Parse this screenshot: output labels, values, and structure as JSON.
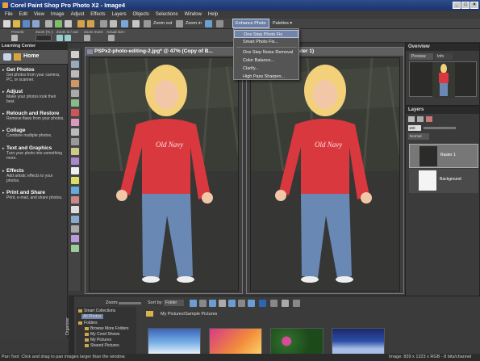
{
  "window": {
    "title": "Corel Paint Shop Pro Photo X2 - Image4",
    "min": "_",
    "max": "□",
    "close": "×"
  },
  "menu": [
    "File",
    "Edit",
    "View",
    "Image",
    "Adjust",
    "Effects",
    "Layers",
    "Objects",
    "Selections",
    "Window",
    "Help"
  ],
  "toolbar": {
    "zoom_out": "Zoom out",
    "zoom_in": "Zoom in",
    "enhance_photo": "Enhance Photo ▾",
    "palettes": "Palettes ▾"
  },
  "tool_options": {
    "presets": "Presets:",
    "zoom_pct": "Zoom (% ):",
    "zoom_in_out": "Zoom in / out:",
    "zoom_more": "Zoom more:",
    "actual_size": "Actual size:"
  },
  "enhance_menu": [
    "One Step Photo Fix",
    "Smart Photo Fix...",
    "One Step Noise Removal",
    "Color Balance...",
    "Clarify...",
    "High Pass Sharpen..."
  ],
  "learning_center": {
    "title": "Learning Center",
    "home": "Home",
    "sections": [
      {
        "heading": "Get Photos",
        "desc": "Get photos from your camera, PC, or scanner."
      },
      {
        "heading": "Adjust",
        "desc": "Make your photos look their best."
      },
      {
        "heading": "Retouch and Restore",
        "desc": "Remove flaws from your photos."
      },
      {
        "heading": "Collage",
        "desc": "Combine multiple photos."
      },
      {
        "heading": "Text and Graphics",
        "desc": "Turn your photo into something more."
      },
      {
        "heading": "Effects",
        "desc": "Add artistic effects to your photos."
      },
      {
        "heading": "Print and Share",
        "desc": "Print, e-mail, and share photos."
      }
    ]
  },
  "image_windows": [
    {
      "title": "PSPx2-photo-editing-2.jpg* @  47% (Copy of B..."
    },
    {
      "title": "aster 1)"
    }
  ],
  "photo_text": "Old Navy",
  "overview": {
    "title": "Overview",
    "tab_preview": "Preview",
    "tab_info": "Info"
  },
  "layers": {
    "title": "Layers",
    "opacity": "100",
    "blend": "Normal",
    "items": [
      {
        "name": "Raster 1"
      },
      {
        "name": "Background"
      }
    ]
  },
  "organizer": {
    "zoom": "Zoom:",
    "sort_by": "Sort by:",
    "sort_value": "Folder",
    "path": "My Pictures\\Sample Pictures",
    "side_label": "Organizer",
    "tree": [
      "Smart Collections",
      "All Photos",
      "Folders",
      "Browse More Folders",
      "My Corel Shows",
      "My Pictures",
      "Shared Pictures"
    ]
  },
  "status": {
    "left": "Pan Tool: Click and drag to pan images larger than the window.",
    "right": "Image:  839 x 1323 x RGB - 8 bits/channel"
  },
  "colors": {
    "title_bar": "#19346e",
    "menu_highlight": "#7384a9",
    "shirt": "#d9383e",
    "jeans": "#6a88b4",
    "hair": "#f2d17a"
  }
}
